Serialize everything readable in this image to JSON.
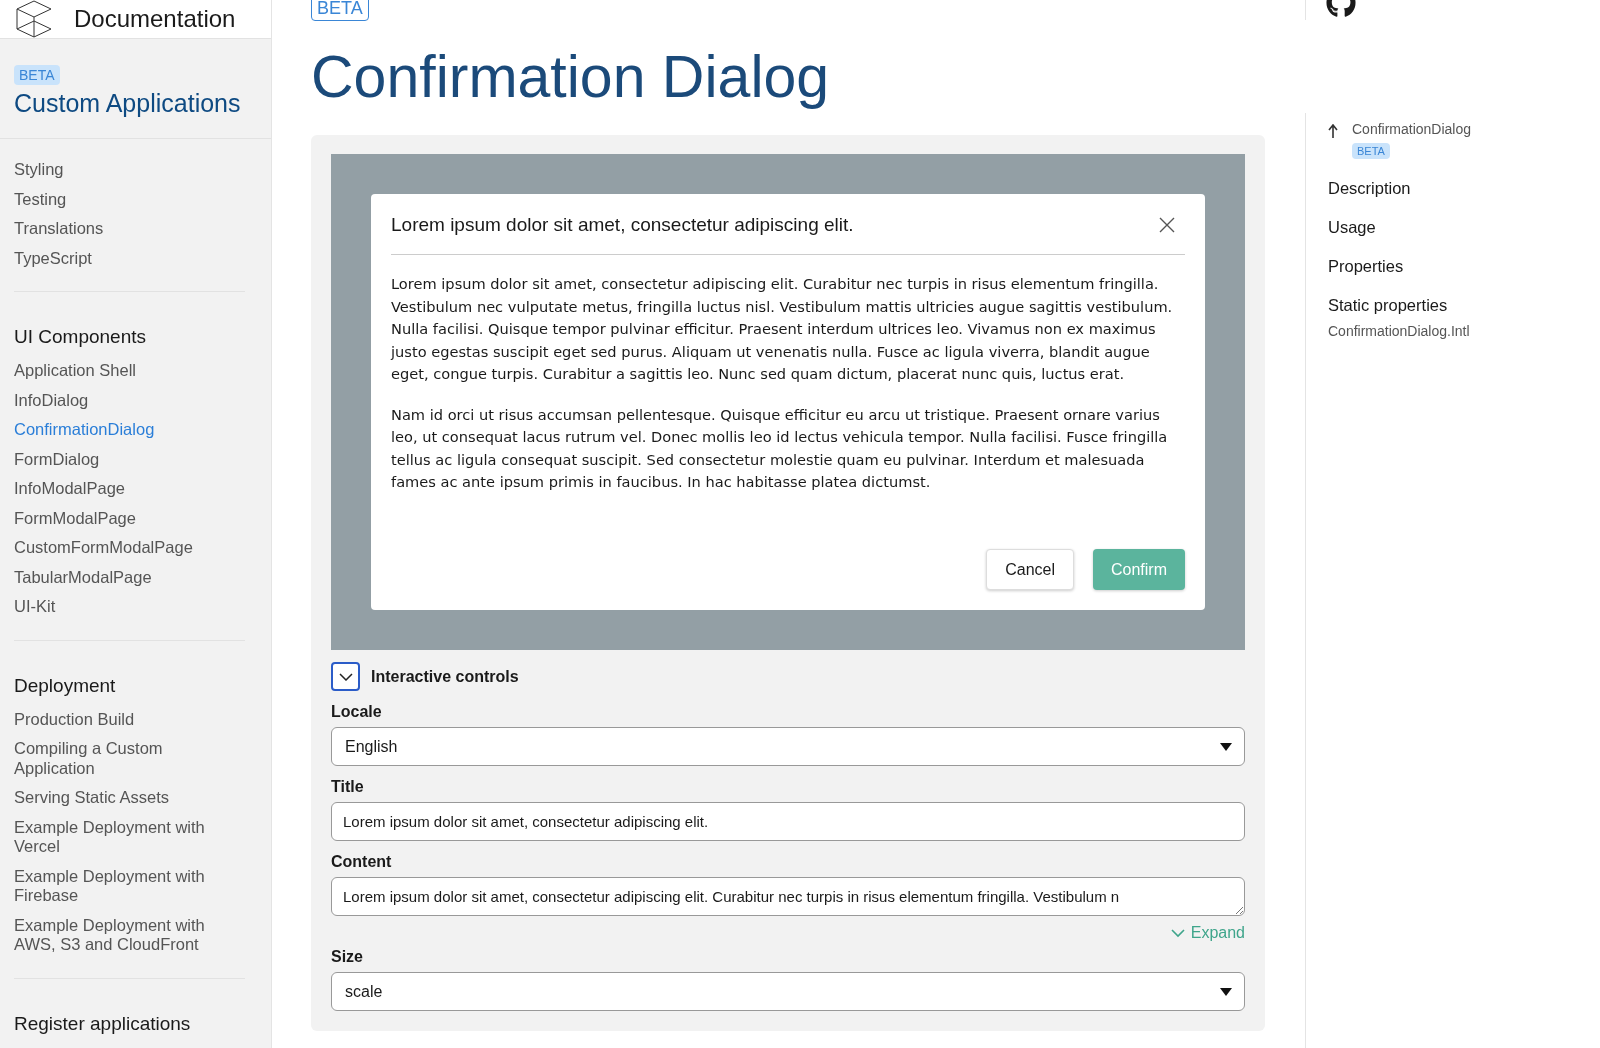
{
  "sidebar": {
    "title": "Documentation",
    "badge": "BETA",
    "section_title": "Custom Applications",
    "groups": [
      {
        "items": [
          {
            "label": "Styling",
            "selected": false
          },
          {
            "label": "Testing",
            "selected": false
          },
          {
            "label": "Translations",
            "selected": false
          },
          {
            "label": "TypeScript",
            "selected": false
          }
        ]
      },
      {
        "title": "UI Components",
        "items": [
          {
            "label": "Application Shell",
            "selected": false
          },
          {
            "label": "InfoDialog",
            "selected": false
          },
          {
            "label": "ConfirmationDialog",
            "selected": true
          },
          {
            "label": "FormDialog",
            "selected": false
          },
          {
            "label": "InfoModalPage",
            "selected": false
          },
          {
            "label": "FormModalPage",
            "selected": false
          },
          {
            "label": "CustomFormModalPage",
            "selected": false
          },
          {
            "label": "TabularModalPage",
            "selected": false
          },
          {
            "label": "UI-Kit",
            "selected": false
          }
        ]
      },
      {
        "title": "Deployment",
        "items": [
          {
            "label": "Production Build",
            "selected": false
          },
          {
            "label": "Compiling a Custom Application",
            "selected": false
          },
          {
            "label": "Serving Static Assets",
            "selected": false
          },
          {
            "label": "Example Deployment with Vercel",
            "selected": false
          },
          {
            "label": "Example Deployment with Firebase",
            "selected": false
          },
          {
            "label": "Example Deployment with AWS, S3 and CloudFront",
            "selected": false
          }
        ]
      },
      {
        "title": "Register applications"
      }
    ]
  },
  "main": {
    "badge": "BETA",
    "title": "Confirmation Dialog",
    "preview": {
      "dialog": {
        "title": "Lorem ipsum dolor sit amet, consectetur adipiscing elit.",
        "paragraphs": [
          "Lorem ipsum dolor sit amet, consectetur adipiscing elit. Curabitur nec turpis in risus elementum fringilla. Vestibulum nec vulputate metus, fringilla luctus nisl. Vestibulum mattis ultricies augue sagittis vestibulum. Nulla facilisi. Quisque tempor pulvinar efficitur. Praesent interdum ultrices leo. Vivamus non ex maximus justo egestas suscipit eget sed purus. Aliquam ut venenatis nulla. Fusce ac ligula viverra, blandit augue eget, congue turpis. Curabitur a sagittis leo. Nunc sed quam dictum, placerat nunc quis, luctus erat.",
          "Nam id orci ut risus accumsan pellentesque. Quisque efficitur eu arcu ut tristique. Praesent ornare varius leo, ut consequat lacus rutrum vel. Donec mollis leo id lectus vehicula tempor. Nulla facilisi. Fusce fringilla tellus ac ligula consequat suscipit. Sed consectetur molestie quam eu pulvinar. Interdum et malesuada fames ac ante ipsum primis in faucibus. In hac habitasse platea dictumst."
        ],
        "buttons": [
          {
            "label": "Cancel",
            "kind": "secondary"
          },
          {
            "label": "Confirm",
            "kind": "primary"
          }
        ]
      }
    },
    "controls": {
      "label": "Interactive controls",
      "expanded": true,
      "fields": [
        {
          "kind": "select",
          "label": "Locale",
          "value": "English"
        },
        {
          "kind": "text",
          "label": "Title",
          "value": "Lorem ipsum dolor sit amet, consectetur adipiscing elit."
        },
        {
          "kind": "textarea",
          "label": "Content",
          "value": "Lorem ipsum dolor sit amet, consectetur adipiscing elit. Curabitur nec turpis in risus elementum fringilla. Vestibulum n",
          "expand": "Expand"
        },
        {
          "kind": "select",
          "label": "Size",
          "value": "scale"
        }
      ]
    }
  },
  "toc": {
    "back": {
      "label": "ConfirmationDialog",
      "badge": "BETA"
    },
    "items": [
      {
        "label": "Description",
        "kind": "heading"
      },
      {
        "label": "Usage",
        "kind": "heading"
      },
      {
        "label": "Properties",
        "kind": "heading"
      },
      {
        "label": "Static properties",
        "kind": "heading"
      },
      {
        "label": "ConfirmationDialog.Intl",
        "kind": "sub"
      }
    ]
  }
}
